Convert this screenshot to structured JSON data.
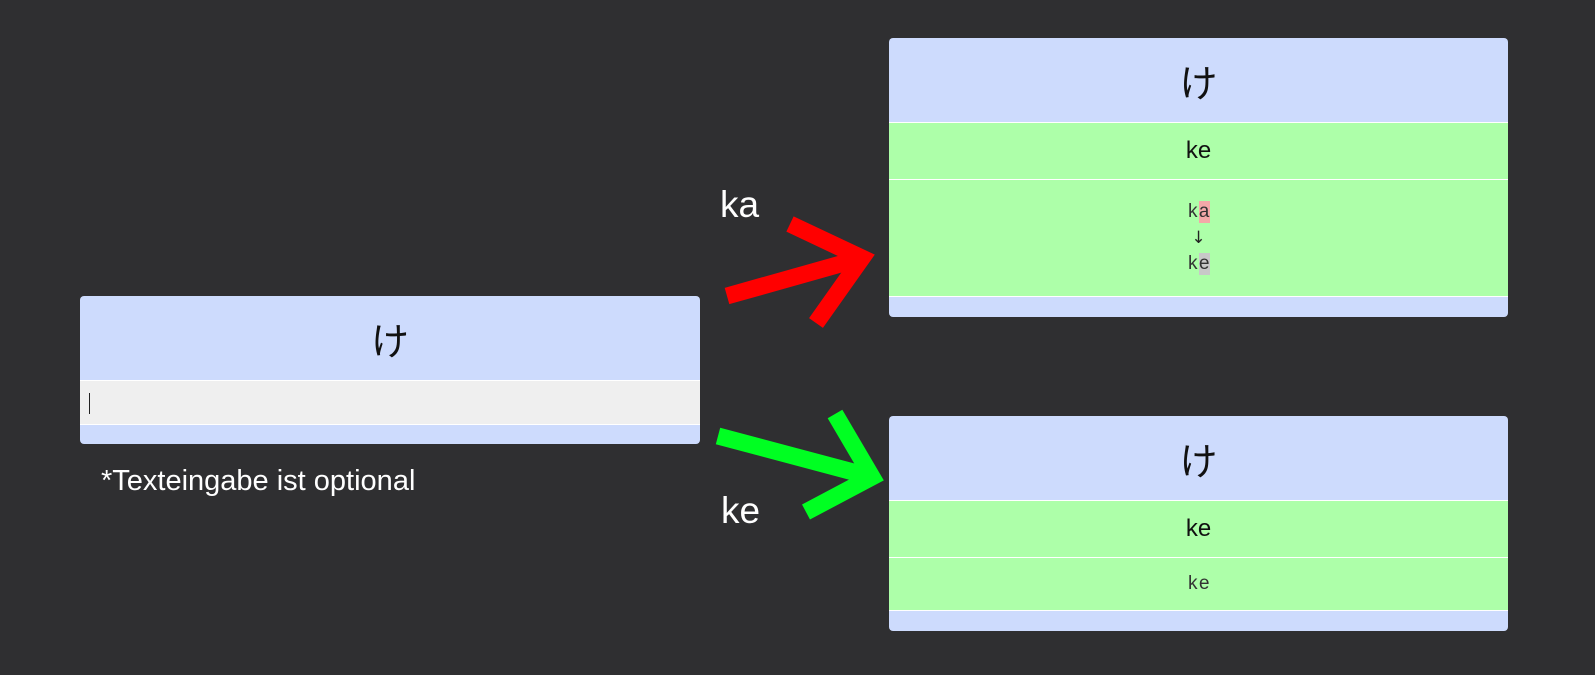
{
  "left_card": {
    "kana": "け",
    "input_value": "",
    "note": "*Texteingabe ist optional"
  },
  "wrong_path": {
    "input_label": "ka",
    "arrow_color": "#ff0000",
    "card": {
      "kana": "け",
      "correct_answer": "ke",
      "typed_prefix": "k",
      "typed_diff": "a",
      "diff_arrow": "↓",
      "expected_prefix": "k",
      "expected_diff": "e"
    }
  },
  "right_path": {
    "input_label": "ke",
    "arrow_color": "#00ff22",
    "card": {
      "kana": "け",
      "correct_answer": "ke",
      "typed": "ke"
    }
  }
}
